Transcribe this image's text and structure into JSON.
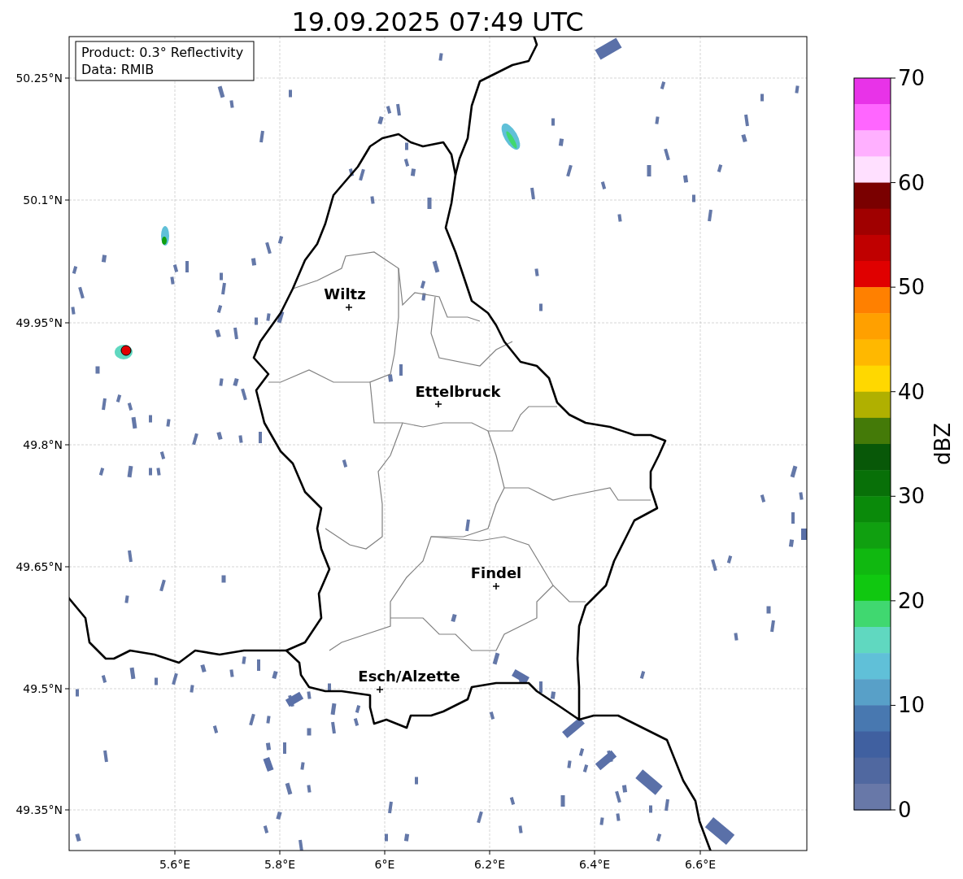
{
  "title": "19.09.2025 07:49 UTC",
  "info_box": {
    "lines": [
      "Product: 0.3° Reflectivity",
      "Data: RMIB"
    ]
  },
  "map": {
    "yticks": [
      "50.25°N",
      "50.1°N",
      "49.95°N",
      "49.8°N",
      "49.65°N",
      "49.5°N",
      "49.35°N"
    ],
    "xticks": [
      "5.6°E",
      "5.8°E",
      "6°E",
      "6.2°E",
      "6.4°E",
      "6.6°E"
    ],
    "places": [
      {
        "name": "Wiltz"
      },
      {
        "name": "Ettelbruck"
      },
      {
        "name": "Findel"
      },
      {
        "name": "Esch/Alzette"
      }
    ]
  },
  "colorbar": {
    "label": "dBZ",
    "ticks": [
      "70",
      "60",
      "50",
      "40",
      "30",
      "20",
      "10",
      "0"
    ],
    "segments": [
      {
        "color": "#e833e8"
      },
      {
        "color": "#ff66ff"
      },
      {
        "color": "#ffb0ff"
      },
      {
        "color": "#ffe0ff"
      },
      {
        "color": "#7a0000"
      },
      {
        "color": "#a00000"
      },
      {
        "color": "#c00000"
      },
      {
        "color": "#e00000"
      },
      {
        "color": "#ff8000"
      },
      {
        "color": "#ffa000"
      },
      {
        "color": "#ffb800"
      },
      {
        "color": "#ffd800"
      },
      {
        "color": "#b0b000"
      },
      {
        "color": "#447a08"
      },
      {
        "color": "#085808"
      },
      {
        "color": "#087008"
      },
      {
        "color": "#0a8a0a"
      },
      {
        "color": "#10a010"
      },
      {
        "color": "#10b810"
      },
      {
        "color": "#10c810"
      },
      {
        "color": "#40d870"
      },
      {
        "color": "#60d8c0"
      },
      {
        "color": "#60c0d8"
      },
      {
        "color": "#58a0c8"
      },
      {
        "color": "#4878b0"
      },
      {
        "color": "#4060a0"
      },
      {
        "color": "#5068a0"
      },
      {
        "color": "#6878a8"
      }
    ]
  }
}
